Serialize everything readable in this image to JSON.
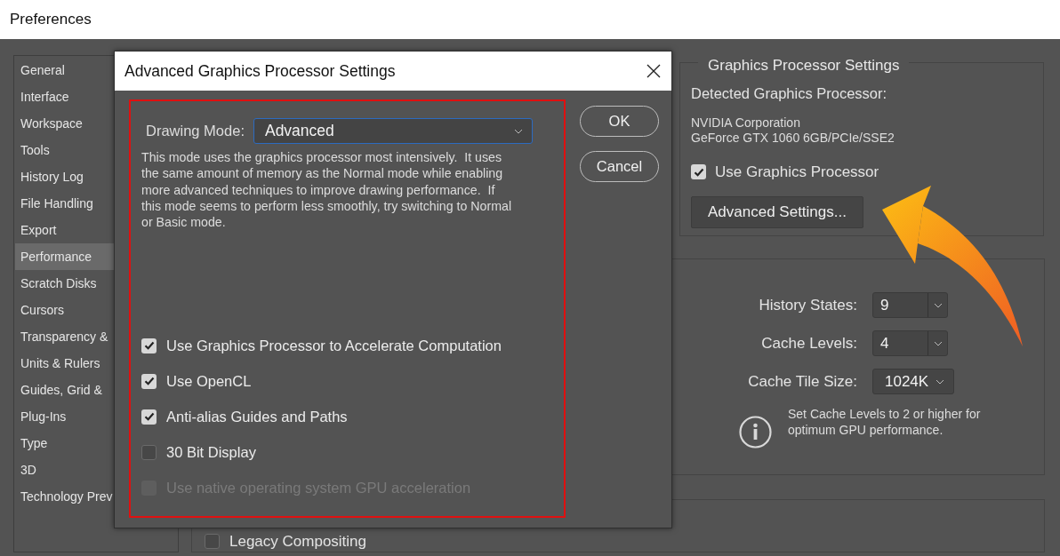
{
  "window": {
    "title": "Preferences"
  },
  "sidebar": {
    "items": [
      {
        "label": "General",
        "selected": false
      },
      {
        "label": "Interface",
        "selected": false
      },
      {
        "label": "Workspace",
        "selected": false
      },
      {
        "label": "Tools",
        "selected": false
      },
      {
        "label": "History Log",
        "selected": false
      },
      {
        "label": "File Handling",
        "selected": false
      },
      {
        "label": "Export",
        "selected": false
      },
      {
        "label": "Performance",
        "selected": true
      },
      {
        "label": "Scratch Disks",
        "selected": false
      },
      {
        "label": "Cursors",
        "selected": false
      },
      {
        "label": "Transparency &",
        "selected": false
      },
      {
        "label": "Units & Rulers",
        "selected": false
      },
      {
        "label": "Guides, Grid &",
        "selected": false
      },
      {
        "label": "Plug-Ins",
        "selected": false
      },
      {
        "label": "Type",
        "selected": false
      },
      {
        "label": "3D",
        "selected": false
      },
      {
        "label": "Technology Prev",
        "selected": false
      }
    ]
  },
  "gpu_settings": {
    "title": "Graphics Processor Settings",
    "detected_label": "Detected Graphics Processor:",
    "gpu_vendor": "NVIDIA Corporation",
    "gpu_model": "GeForce GTX 1060 6GB/PCIe/SSE2",
    "use_gpu": {
      "label": "Use Graphics Processor",
      "checked": true
    },
    "advanced_button": "Advanced Settings..."
  },
  "history_cache": {
    "fields": [
      {
        "label": "History States:",
        "value": "9",
        "kind": "spin"
      },
      {
        "label": "Cache Levels:",
        "value": "4",
        "kind": "spin"
      },
      {
        "label": "Cache Tile Size:",
        "value": "1024K",
        "kind": "dropdown"
      }
    ],
    "info": "Set Cache Levels to 2 or higher for optimum GPU performance."
  },
  "legacy": {
    "label": "Legacy Compositing",
    "checked": false
  },
  "dialog": {
    "title": "Advanced Graphics Processor Settings",
    "drawing_mode_label": "Drawing Mode:",
    "drawing_mode": "Advanced",
    "description": "This mode uses the graphics processor most intensively.  It uses the same amount of memory as the Normal mode while enabling more advanced techniques to improve drawing performance.  If this mode seems to perform less smoothly, try switching to Normal or Basic mode.",
    "options": [
      {
        "label": "Use Graphics Processor to Accelerate Computation",
        "checked": true,
        "disabled": false
      },
      {
        "label": "Use OpenCL",
        "checked": true,
        "disabled": false
      },
      {
        "label": "Anti-alias Guides and Paths",
        "checked": true,
        "disabled": false
      },
      {
        "label": "30 Bit Display",
        "checked": false,
        "disabled": false
      },
      {
        "label": "Use native operating system GPU acceleration",
        "checked": false,
        "disabled": true
      }
    ],
    "buttons": [
      "OK",
      "Cancel"
    ]
  }
}
